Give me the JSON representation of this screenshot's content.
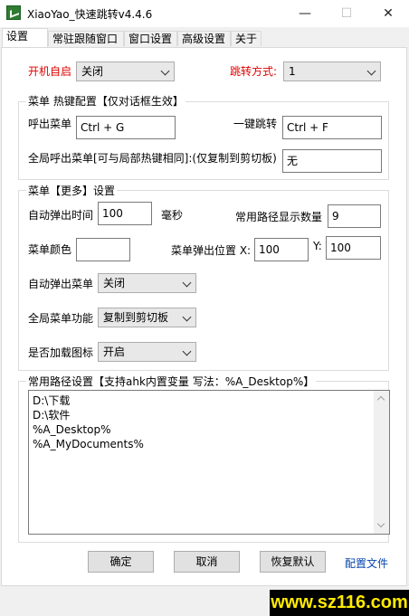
{
  "window": {
    "title": "XiaoYao_快速跳转v4.4.6",
    "minimize": "—",
    "maximize": "☐",
    "close": "✕"
  },
  "tabs": [
    "设置",
    "常驻跟随窗口",
    "窗口设置",
    "高级设置",
    "关于"
  ],
  "startup": {
    "label": "开机自启",
    "value": "关闭"
  },
  "jump_mode": {
    "label": "跳转方式:",
    "value": "1"
  },
  "hotkey_group": {
    "title": "菜单 热键配置【仅对话框生效】",
    "call_menu_label": "呼出菜单",
    "call_menu_value": "Ctrl + G",
    "one_key_jump_label": "一键跳转",
    "one_key_jump_value": "Ctrl + F",
    "global_menu_label": "全局呼出菜单[可与局部热键相同]:(仅复制到剪切板)",
    "global_menu_value": "无"
  },
  "more_group": {
    "title": "菜单【更多】设置",
    "auto_popup_time_label": "自动弹出时间",
    "auto_popup_time_value": "100",
    "ms_label": "毫秒",
    "path_count_label": "常用路径显示数量",
    "path_count_value": "9",
    "menu_color_label": "菜单颜色",
    "menu_color_value": "",
    "menu_pos_label": "菜单弹出位置 X:",
    "menu_pos_x": "100",
    "menu_pos_y_label": "Y:",
    "menu_pos_y": "100",
    "auto_popup_label": "自动弹出菜单",
    "auto_popup_value": "关闭",
    "global_func_label": "全局菜单功能",
    "global_func_value": "复制到剪切板",
    "load_icon_label": "是否加载图标",
    "load_icon_value": "开启"
  },
  "paths_group": {
    "title": "常用路径设置【支持ahk内置变量 写法：%A_Desktop%】",
    "lines": [
      "D:\\下载",
      "D:\\软件",
      "%A_Desktop%",
      "%A_MyDocuments%"
    ]
  },
  "buttons": {
    "ok": "确定",
    "cancel": "取消",
    "restore": "恢复默认",
    "config_file": "配置文件"
  },
  "watermark": "www.sz116.com"
}
